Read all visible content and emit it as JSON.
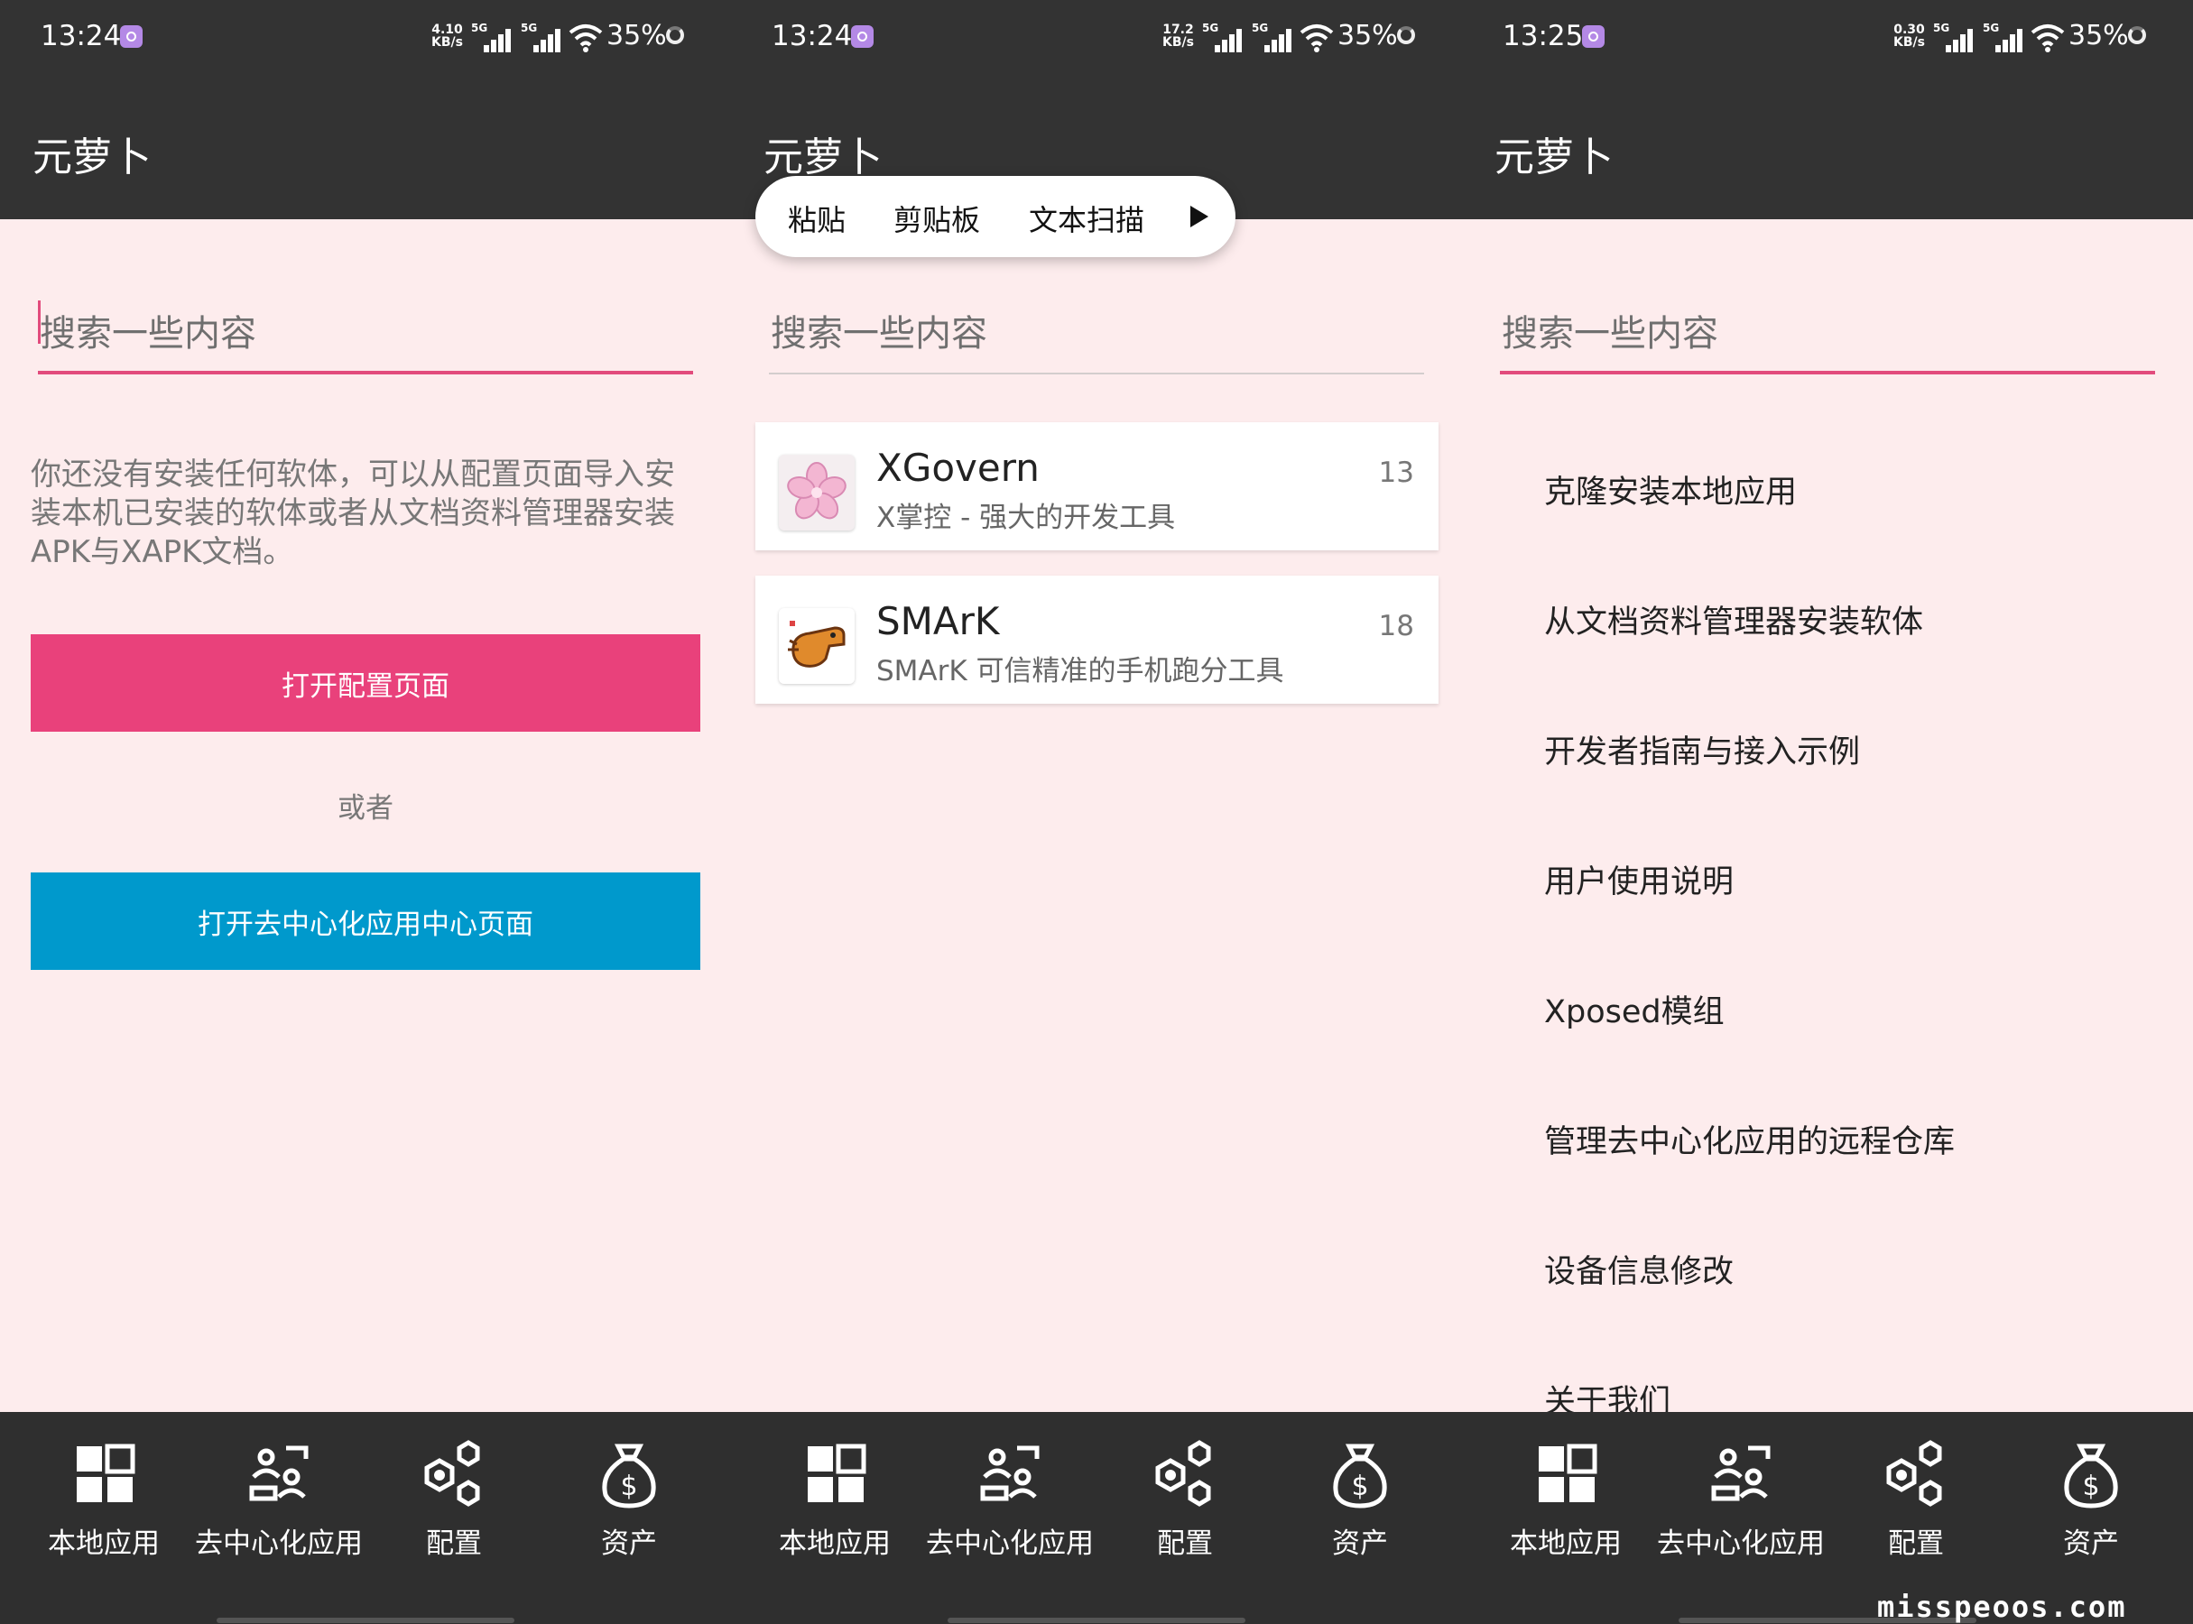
{
  "screens": [
    {
      "time": "13:24",
      "net_speed_value": "4.10",
      "net_speed_unit": "KB/s",
      "signal_label": "5G",
      "battery": "35%",
      "app_title": "元萝卜",
      "search_placeholder": "搜索一些内容",
      "empty_message": "你还没有安装任何软体，可以从配置页面导入安装本机已安装的软体或者从文档资料管理器安装APK与XAPK文档。",
      "open_config_button": "打开配置页面",
      "or_text": "或者",
      "open_decentral_button": "打开去中心化应用中心页面"
    },
    {
      "time": "13:24",
      "net_speed_value": "17.2",
      "net_speed_unit": "KB/s",
      "signal_label": "5G",
      "battery": "35%",
      "app_title": "元萝卜",
      "context_menu": [
        "粘贴",
        "剪贴板",
        "文本扫描"
      ],
      "search_placeholder": "搜索一些内容",
      "apps": [
        {
          "name": "XGovern",
          "desc": "X掌控 - 强大的开发工具",
          "count": "13",
          "icon": "sakura-icon"
        },
        {
          "name": "SMArK",
          "desc": "SMArK 可信精准的手机跑分工具",
          "count": "18",
          "icon": "dinosaur-icon"
        }
      ]
    },
    {
      "time": "13:25",
      "net_speed_value": "0.30",
      "net_speed_unit": "KB/s",
      "signal_label": "5G",
      "battery": "35%",
      "app_title": "元萝卜",
      "search_placeholder": "搜索一些内容",
      "menu": [
        "克隆安装本地应用",
        "从文档资料管理器安装软体",
        "开发者指南与接入示例",
        "用户使用说明",
        "Xposed模组",
        "管理去中心化应用的远程仓库",
        "设备信息修改",
        "关于我们"
      ]
    }
  ],
  "nav": [
    {
      "label": "本地应用",
      "icon": "grid-icon"
    },
    {
      "label": "去中心化应用",
      "icon": "people-icon"
    },
    {
      "label": "配置",
      "icon": "gears-icon"
    },
    {
      "label": "资产",
      "icon": "money-bag-icon"
    }
  ],
  "watermark": "misspeoos.com",
  "colors": {
    "accent_pink": "#e9417b",
    "accent_blue": "#0099cc",
    "bar_dark": "#333333",
    "background": "#fdeced"
  }
}
